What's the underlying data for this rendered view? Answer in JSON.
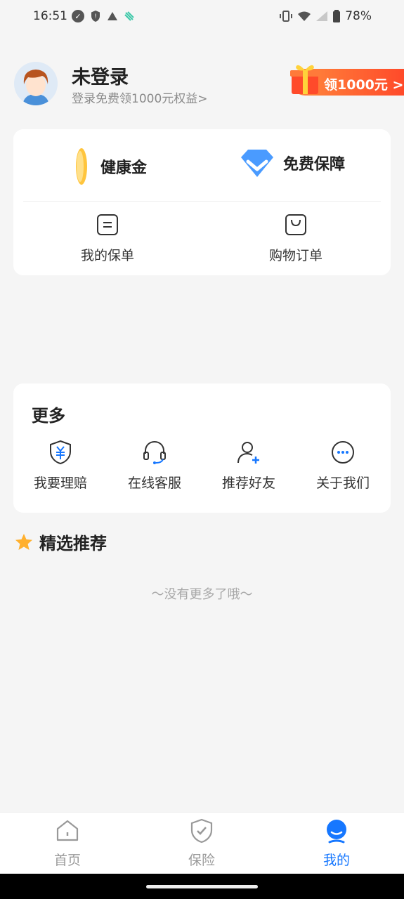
{
  "status": {
    "time": "16:51",
    "battery": "78%"
  },
  "profile": {
    "name": "未登录",
    "subtitle": "登录免费领1000元权益>"
  },
  "promo": {
    "label": "领1000元 >"
  },
  "features": [
    {
      "label": "健康金",
      "icon": "gold-coin-icon"
    },
    {
      "label": "免费保障",
      "icon": "diamond-icon"
    }
  ],
  "quick_links": [
    {
      "label": "我的保单",
      "icon": "policy-icon"
    },
    {
      "label": "购物订单",
      "icon": "shopping-bag-icon"
    }
  ],
  "more": {
    "title": "更多",
    "items": [
      {
        "label": "我要理赔",
        "icon": "shield-yen-icon"
      },
      {
        "label": "在线客服",
        "icon": "headset-icon"
      },
      {
        "label": "推荐好友",
        "icon": "add-user-icon"
      },
      {
        "label": "关于我们",
        "icon": "more-dots-icon"
      }
    ]
  },
  "recommend": {
    "title": "精选推荐",
    "empty": "〜没有更多了哦〜"
  },
  "tabs": [
    {
      "label": "首页",
      "icon": "home-icon"
    },
    {
      "label": "保险",
      "icon": "shield-check-icon"
    },
    {
      "label": "我的",
      "icon": "profile-icon",
      "active": true
    }
  ],
  "colors": {
    "accent": "#1677ff",
    "promo": "#ff5a2e",
    "background": "#f5f5f5"
  }
}
